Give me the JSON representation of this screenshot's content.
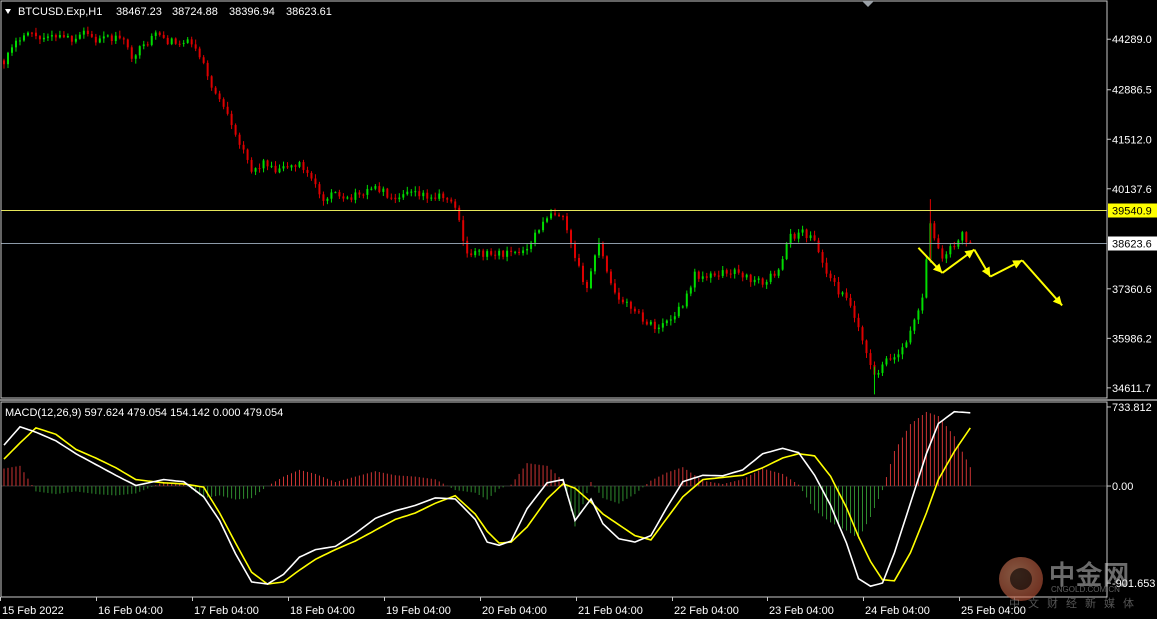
{
  "chart_data": [
    {
      "type": "candlestick",
      "title": "BTCUSD.Exp,H1",
      "ohlc_readout": [
        "38467.23",
        "38724.88",
        "38396.94",
        "38623.61"
      ],
      "y_ticks": [
        "44289.0",
        "42886.5",
        "41512.0",
        "40137.6",
        "37360.6",
        "35986.2",
        "34611.7"
      ],
      "y_ticks_values": [
        44289.0,
        42886.5,
        41512.0,
        40137.6,
        37360.6,
        35986.2,
        34611.7
      ],
      "ylim": [
        34330,
        45350
      ],
      "x_ticks": [
        "15 Feb 2022",
        "16 Feb 04:00",
        "17 Feb 04:00",
        "18 Feb 04:00",
        "19 Feb 04:00",
        "20 Feb 04:00",
        "21 Feb 04:00",
        "22 Feb 04:00",
        "23 Feb 04:00",
        "24 Feb 04:00",
        "25 Feb 04:00"
      ],
      "horizontal_lines": [
        {
          "label": "39540.9",
          "value": 39540.9,
          "color": "#e6e65a",
          "label_bg": "#ffff00",
          "label_color": "#000000"
        },
        {
          "label": "38623.6",
          "value": 38623.6,
          "color": "#8c9aa8",
          "label_bg": "#ffffff",
          "label_color": "#000000"
        }
      ],
      "up_color": "#00dd00",
      "down_color": "#dd0000",
      "forecast_color": "#ffff00",
      "forecast_path": [
        {
          "hour": 229,
          "price": 38500
        },
        {
          "hour": 235,
          "price": 37800
        },
        {
          "hour": 243,
          "price": 38450
        },
        {
          "hour": 247,
          "price": 37700
        },
        {
          "hour": 255,
          "price": 38150
        },
        {
          "hour": 265,
          "price": 36900
        }
      ],
      "anchors": [
        [
          0,
          43700
        ],
        [
          2,
          44000
        ],
        [
          5,
          44500
        ],
        [
          8,
          44400
        ],
        [
          11,
          44300
        ],
        [
          14,
          44450
        ],
        [
          17,
          44300
        ],
        [
          20,
          44550
        ],
        [
          23,
          44250
        ],
        [
          26,
          44300
        ],
        [
          29,
          44350
        ],
        [
          32,
          43850
        ],
        [
          35,
          44100
        ],
        [
          38,
          44450
        ],
        [
          41,
          44250
        ],
        [
          44,
          44150
        ],
        [
          47,
          44200
        ],
        [
          50,
          43550
        ],
        [
          53,
          42750
        ],
        [
          56,
          42300
        ],
        [
          59,
          41400
        ],
        [
          62,
          40600
        ],
        [
          65,
          40850
        ],
        [
          68,
          40600
        ],
        [
          71,
          40750
        ],
        [
          74,
          40800
        ],
        [
          77,
          40500
        ],
        [
          80,
          39700
        ],
        [
          83,
          40050
        ],
        [
          86,
          39900
        ],
        [
          89,
          39950
        ],
        [
          92,
          40200
        ],
        [
          95,
          40050
        ],
        [
          98,
          39750
        ],
        [
          101,
          40000
        ],
        [
          104,
          39950
        ],
        [
          107,
          39900
        ],
        [
          110,
          39900
        ],
        [
          113,
          39650
        ],
        [
          116,
          38350
        ],
        [
          119,
          38350
        ],
        [
          122,
          38300
        ],
        [
          125,
          38350
        ],
        [
          128,
          38300
        ],
        [
          131,
          38550
        ],
        [
          134,
          39050
        ],
        [
          137,
          39400
        ],
        [
          140,
          39300
        ],
        [
          143,
          38150
        ],
        [
          146,
          37400
        ],
        [
          149,
          38700
        ],
        [
          152,
          37500
        ],
        [
          155,
          36950
        ],
        [
          158,
          36800
        ],
        [
          161,
          36400
        ],
        [
          164,
          36300
        ],
        [
          167,
          36550
        ],
        [
          170,
          36950
        ],
        [
          173,
          37750
        ],
        [
          176,
          37650
        ],
        [
          179,
          37800
        ],
        [
          182,
          37850
        ],
        [
          185,
          37750
        ],
        [
          188,
          37550
        ],
        [
          191,
          37550
        ],
        [
          194,
          37950
        ],
        [
          197,
          38800
        ],
        [
          200,
          38950
        ],
        [
          203,
          38700
        ],
        [
          206,
          37800
        ],
        [
          209,
          37300
        ],
        [
          212,
          36900
        ],
        [
          215,
          35850
        ],
        [
          218,
          34900
        ],
        [
          221,
          35350
        ],
        [
          224,
          35550
        ],
        [
          227,
          36150
        ],
        [
          230,
          37150
        ],
        [
          232,
          39100
        ],
        [
          235,
          38200
        ],
        [
          238,
          38600
        ],
        [
          240,
          38850
        ],
        [
          242,
          38560
        ]
      ]
    },
    {
      "type": "macd",
      "title": "MACD(12,26,9) 597.624 479.054 154.142 0.000 479.054",
      "y_ticks": [
        "733.812",
        "0.00",
        "-901.653"
      ],
      "y_ticks_values": [
        733.812,
        0.0,
        -901.653
      ],
      "ylim": [
        -1030,
        780
      ],
      "macd_color": "#ffffff",
      "signal_color": "#ffff00",
      "hist_pos_color": "#cc3333",
      "hist_neg_color": "#2e8b2e",
      "macd_anchors": [
        [
          0,
          380
        ],
        [
          4,
          550
        ],
        [
          8,
          500
        ],
        [
          13,
          420
        ],
        [
          18,
          300
        ],
        [
          23,
          200
        ],
        [
          28,
          100
        ],
        [
          33,
          5
        ],
        [
          40,
          60
        ],
        [
          45,
          40
        ],
        [
          50,
          -100
        ],
        [
          54,
          -320
        ],
        [
          58,
          -630
        ],
        [
          62,
          -890
        ],
        [
          66,
          -910
        ],
        [
          70,
          -820
        ],
        [
          74,
          -660
        ],
        [
          78,
          -590
        ],
        [
          83,
          -560
        ],
        [
          88,
          -440
        ],
        [
          93,
          -300
        ],
        [
          98,
          -230
        ],
        [
          103,
          -180
        ],
        [
          108,
          -110
        ],
        [
          113,
          -120
        ],
        [
          118,
          -310
        ],
        [
          121,
          -520
        ],
        [
          124,
          -550
        ],
        [
          127,
          -510
        ],
        [
          131,
          -210
        ],
        [
          136,
          30
        ],
        [
          140,
          60
        ],
        [
          143,
          -320
        ],
        [
          147,
          -120
        ],
        [
          150,
          -350
        ],
        [
          154,
          -490
        ],
        [
          158,
          -520
        ],
        [
          162,
          -460
        ],
        [
          166,
          -200
        ],
        [
          170,
          40
        ],
        [
          175,
          100
        ],
        [
          180,
          95
        ],
        [
          185,
          150
        ],
        [
          190,
          300
        ],
        [
          195,
          350
        ],
        [
          199,
          310
        ],
        [
          203,
          100
        ],
        [
          207,
          -180
        ],
        [
          211,
          -530
        ],
        [
          214,
          -860
        ],
        [
          217,
          -930
        ],
        [
          220,
          -900
        ],
        [
          223,
          -620
        ],
        [
          227,
          -160
        ],
        [
          231,
          300
        ],
        [
          234,
          580
        ],
        [
          238,
          690
        ],
        [
          242,
          680
        ]
      ],
      "signal_anchors": [
        [
          0,
          250
        ],
        [
          4,
          400
        ],
        [
          8,
          540
        ],
        [
          13,
          480
        ],
        [
          18,
          340
        ],
        [
          23,
          260
        ],
        [
          28,
          170
        ],
        [
          33,
          60
        ],
        [
          40,
          30
        ],
        [
          45,
          20
        ],
        [
          50,
          -10
        ],
        [
          54,
          -250
        ],
        [
          58,
          -530
        ],
        [
          62,
          -800
        ],
        [
          66,
          -910
        ],
        [
          70,
          -890
        ],
        [
          74,
          -780
        ],
        [
          78,
          -680
        ],
        [
          83,
          -590
        ],
        [
          88,
          -510
        ],
        [
          93,
          -410
        ],
        [
          98,
          -310
        ],
        [
          103,
          -250
        ],
        [
          108,
          -160
        ],
        [
          113,
          -90
        ],
        [
          118,
          -260
        ],
        [
          121,
          -420
        ],
        [
          124,
          -530
        ],
        [
          127,
          -520
        ],
        [
          131,
          -380
        ],
        [
          136,
          -120
        ],
        [
          140,
          20
        ],
        [
          143,
          -20
        ],
        [
          147,
          -150
        ],
        [
          150,
          -260
        ],
        [
          154,
          -360
        ],
        [
          158,
          -460
        ],
        [
          162,
          -500
        ],
        [
          166,
          -300
        ],
        [
          170,
          -100
        ],
        [
          175,
          60
        ],
        [
          180,
          80
        ],
        [
          185,
          100
        ],
        [
          190,
          170
        ],
        [
          195,
          260
        ],
        [
          199,
          300
        ],
        [
          203,
          280
        ],
        [
          207,
          90
        ],
        [
          211,
          -200
        ],
        [
          214,
          -470
        ],
        [
          217,
          -700
        ],
        [
          220,
          -870
        ],
        [
          223,
          -880
        ],
        [
          227,
          -620
        ],
        [
          231,
          -250
        ],
        [
          234,
          60
        ],
        [
          238,
          320
        ],
        [
          242,
          540
        ]
      ]
    }
  ],
  "watermark": {
    "name": "中金网",
    "site": "CNGOLD.COM.CN",
    "sub": "中文财经新媒体"
  }
}
